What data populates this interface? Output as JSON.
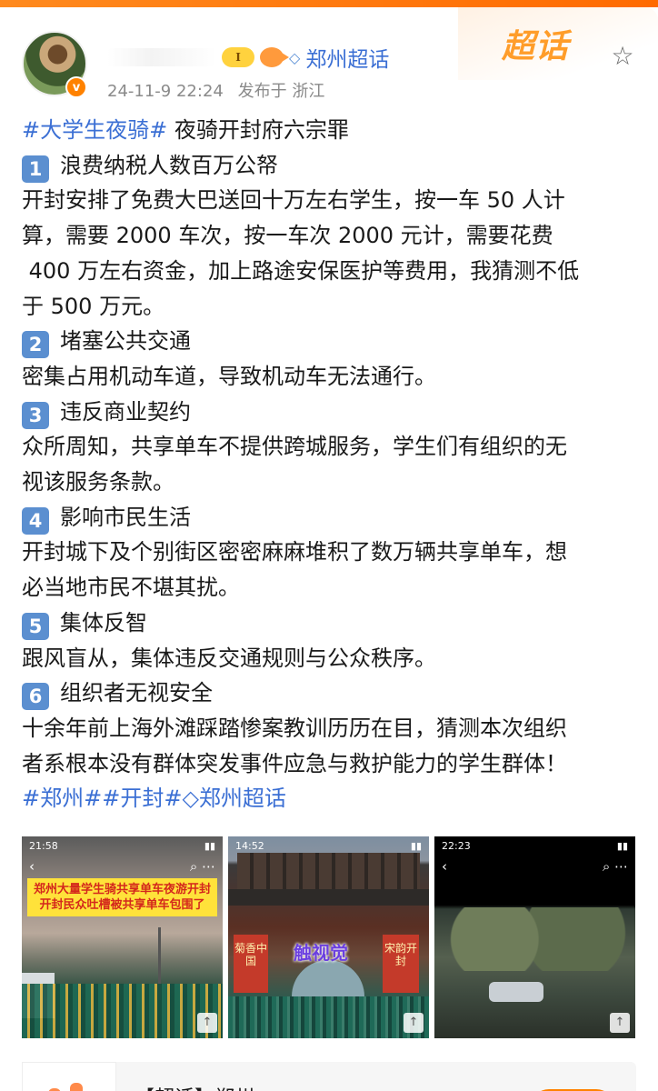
{
  "header": {
    "super_topic": "郑州超话",
    "badge_level": "I",
    "date": "24-11-9 22:24",
    "location": "发布于 浙江",
    "brand": "超话",
    "verified_mark": "v"
  },
  "post": {
    "line1_tag": "#大学生夜骑#",
    "line1_text": " 夜骑开封府六宗罪",
    "items": [
      {
        "num": "1",
        "title": "浪费纳税人数百万公帑",
        "lines": [
          "开封安排了免费大巴送回十万左右学生，按一车 50 人计",
          "算，需要 2000 车次，按一车次 2000 元计，需要花费",
          " 400 万左右资金，加上路途安保医护等费用，我猜测不低",
          "于 500 万元。"
        ]
      },
      {
        "num": "2",
        "title": "堵塞公共交通",
        "lines": [
          "密集占用机动车道，导致机动车无法通行。"
        ]
      },
      {
        "num": "3",
        "title": "违反商业契约",
        "lines": [
          "众所周知，共享单车不提供跨城服务，学生们有组织的无",
          "视该服务条款。"
        ]
      },
      {
        "num": "4",
        "title": "影响市民生活",
        "lines": [
          "开封城下及个别街区密密麻麻堆积了数万辆共享单车，想",
          "必当地市民不堪其扰。"
        ]
      },
      {
        "num": "5",
        "title": "集体反智",
        "lines": [
          "跟风盲从，集体违反交通规则与公众秩序。"
        ]
      },
      {
        "num": "6",
        "title": "组织者无视安全",
        "lines": [
          "十余年前上海外滩踩踏惨案教训历历在目，猜测本次组织",
          "者系根本没有群体突发事件应急与救护能力的学生群体！"
        ]
      }
    ],
    "footer_tags": [
      "#郑州#",
      "#开封#",
      "郑州超话"
    ]
  },
  "photos": [
    {
      "time": "21:58",
      "caption": "郑州大量学生骑共享单车夜游开封开封民众吐槽被共享单车包围了"
    },
    {
      "time": "14:52",
      "watermark": "触视觉",
      "banner_left": "菊香中国",
      "banner_right": "宋韵开封"
    },
    {
      "time": "22:23"
    }
  ],
  "link_card": {
    "title": "【超话】郑州"
  },
  "icons": {
    "star": "star-outline-icon",
    "back": "back-arrow-icon",
    "search": "search-icon",
    "more": "more-dots-icon"
  },
  "colors": {
    "link_blue": "#3b6fd4",
    "number_badge": "#5b8fd0",
    "brand_orange": "#ff9d2a"
  }
}
